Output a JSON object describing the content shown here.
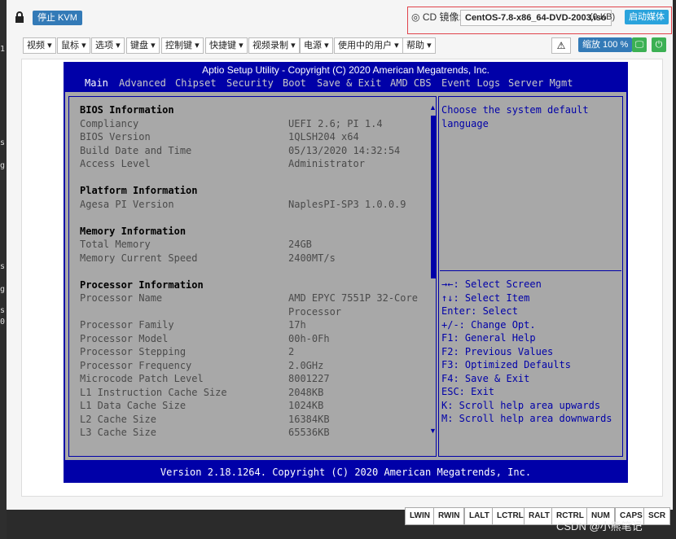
{
  "topbar": {
    "stop_kvm_label": "停止 KVM",
    "cd_label": "CD 镜像:",
    "iso_name": "CentOS-7.8-x86_64-DVD-2003.iso",
    "iso_size": "(0 KB)",
    "start_media_label": "启动媒体"
  },
  "menu": [
    {
      "label": "视频"
    },
    {
      "label": "鼠标"
    },
    {
      "label": "选项"
    },
    {
      "label": "键盘"
    },
    {
      "label": "控制键"
    },
    {
      "label": "快捷键"
    },
    {
      "label": "视频录制"
    },
    {
      "label": "电源"
    },
    {
      "label": "使用中的用户"
    },
    {
      "label": "帮助"
    }
  ],
  "toolbar": {
    "warn_label": "⚠",
    "zoom_label": "缩放 100 %",
    "screen_label": "🖵",
    "power_label": "⏻"
  },
  "bios": {
    "title": "Aptio Setup Utility - Copyright (C) 2020 American Megatrends, Inc.",
    "tabs": [
      "Main",
      "Advanced",
      "Chipset",
      "Security",
      "Boot",
      "Save & Exit",
      "AMD CBS",
      "Event Logs",
      "Server Mgmt"
    ],
    "sections": [
      {
        "heading": "BIOS Information",
        "rows": [
          {
            "key": "Compliancy",
            "value": "UEFI 2.6; PI 1.4"
          },
          {
            "key": "BIOS Version",
            "value": "1QLSH204 x64"
          },
          {
            "key": "Build Date and Time",
            "value": "05/13/2020 14:32:54"
          },
          {
            "key": "Access Level",
            "value": "Administrator"
          }
        ]
      },
      {
        "heading": "Platform Information",
        "rows": [
          {
            "key": "Agesa PI Version",
            "value": "NaplesPI-SP3 1.0.0.9"
          }
        ]
      },
      {
        "heading": "Memory Information",
        "rows": [
          {
            "key": "Total Memory",
            "value": "24GB"
          },
          {
            "key": "Memory Current Speed",
            "value": "2400MT/s"
          }
        ]
      },
      {
        "heading": "Processor Information",
        "rows": [
          {
            "key": "Processor Name",
            "value": "AMD EPYC 7551P 32-Core"
          },
          {
            "key": "",
            "value": "Processor"
          },
          {
            "key": "Processor Family",
            "value": "17h"
          },
          {
            "key": "Processor Model",
            "value": "00h-0Fh"
          },
          {
            "key": "Processor Stepping",
            "value": "2"
          },
          {
            "key": "Processor Frequency",
            "value": "2.0GHz"
          },
          {
            "key": "Microcode Patch Level",
            "value": "8001227"
          },
          {
            "key": "L1 Instruction Cache Size",
            "value": "2048KB"
          },
          {
            "key": "L1 Data Cache Size",
            "value": "1024KB"
          },
          {
            "key": "L2 Cache Size",
            "value": "16384KB"
          },
          {
            "key": "L3 Cache Size",
            "value": "65536KB"
          }
        ]
      }
    ],
    "help_top": [
      "Choose the system default",
      "language"
    ],
    "help_keys": [
      "→←: Select Screen",
      "↑↓: Select Item",
      "Enter: Select",
      "+/-: Change Opt.",
      "F1: General Help",
      "F2: Previous Values",
      "F3: Optimized Defaults",
      "F4: Save & Exit",
      "ESC: Exit",
      "K: Scroll help area upwards",
      "M: Scroll help area downwards"
    ],
    "footer": "Version 2.18.1264. Copyright (C) 2020 American Megatrends, Inc."
  },
  "keys": [
    "LWIN",
    "RWIN",
    "LALT",
    "LCTRL",
    "RALT",
    "RCTRL",
    "NUM",
    "CAPS",
    "SCR"
  ],
  "left_strip_chars": [
    "1",
    "s",
    "g",
    "s",
    "g",
    "s",
    "0"
  ],
  "watermark": "CSDN @小熊笔记",
  "colors": {
    "bios_blue": "#0000a8",
    "bios_gray": "#a8a8a8",
    "primary": "#337ab7",
    "success": "#3cb054",
    "highlight": "#e0434b"
  }
}
